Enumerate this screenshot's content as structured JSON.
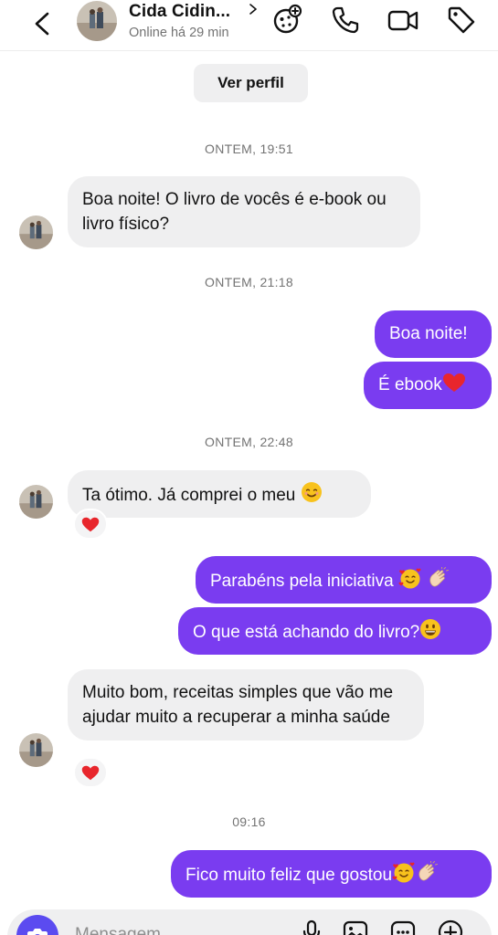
{
  "header": {
    "contact_name": "Cida Cidin...",
    "status": "Online há 29 min"
  },
  "profile_button": "Ver perfil",
  "messages": {
    "t1": "ONTEM, 19:51",
    "m1": "Boa noite! O livro de vocês é e-book ou livro físico?",
    "t2": "ONTEM, 21:18",
    "m2": "Boa noite!",
    "m3": "É ebook",
    "t3": "ONTEM, 22:48",
    "m4": "Ta ótimo. Já comprei o meu",
    "m5": "Parabéns pela iniciativa",
    "m6": "O que está achando do livro?",
    "m7": "Muito bom, receitas simples que vão me ajudar muito a recuperar a minha saúde",
    "t4": "09:16",
    "m8": "Fico muito feliz que gostou"
  },
  "composer": {
    "placeholder": "Mensagem..."
  },
  "colors": {
    "outgoing": "#7a3cf0",
    "incoming": "#efeff0",
    "camera": "#5b4bf0"
  }
}
